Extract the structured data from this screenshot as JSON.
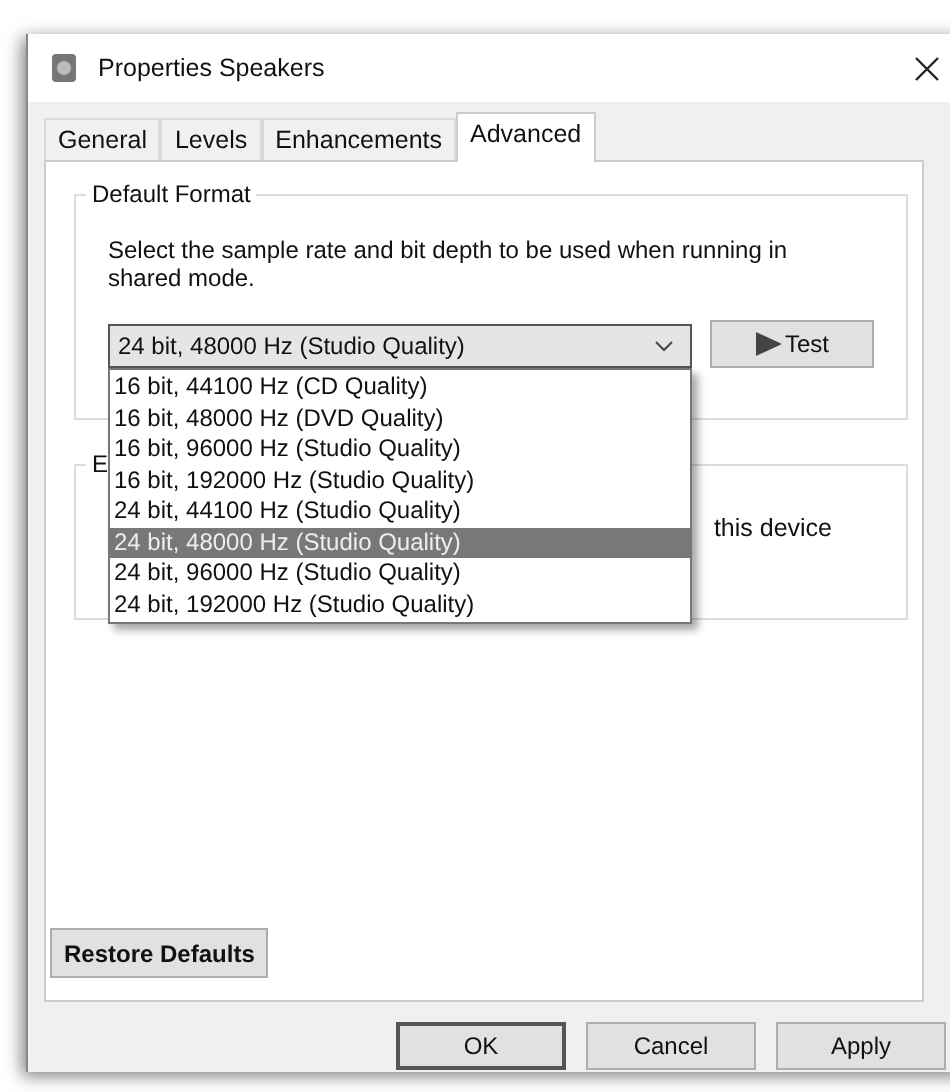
{
  "window": {
    "title": "Properties Speakers"
  },
  "tabs": [
    {
      "label": "General",
      "selected": false
    },
    {
      "label": "Levels",
      "selected": false
    },
    {
      "label": "Enhancements",
      "selected": false
    },
    {
      "label": "Advanced",
      "selected": true
    }
  ],
  "default_format": {
    "legend": "Default Format",
    "description": "Select the sample rate and bit depth to be used when running in shared mode.",
    "combo": {
      "value": "24 bit, 48000 Hz (Studio Quality)",
      "expanded": true
    },
    "test_button": "Test",
    "options": [
      {
        "label": "16 bit, 44100 Hz (CD Quality)",
        "selected": false
      },
      {
        "label": "16 bit, 48000 Hz (DVD Quality)",
        "selected": false
      },
      {
        "label": "16 bit, 96000 Hz (Studio Quality)",
        "selected": false
      },
      {
        "label": "16 bit, 192000 Hz (Studio Quality)",
        "selected": false
      },
      {
        "label": "24 bit, 44100 Hz (Studio Quality)",
        "selected": false
      },
      {
        "label": "24 bit, 48000 Hz (Studio Quality)",
        "selected": true
      },
      {
        "label": "24 bit, 96000 Hz (Studio Quality)",
        "selected": false
      },
      {
        "label": "24 bit, 192000 Hz (Studio Quality)",
        "selected": false
      }
    ]
  },
  "exclusive_mode": {
    "legend": "E",
    "text": "this device"
  },
  "restore_button": "Restore Defaults",
  "buttons": [
    {
      "label": "OK",
      "default": true
    },
    {
      "label": "Cancel",
      "default": false
    },
    {
      "label": "Apply",
      "default": false
    }
  ]
}
